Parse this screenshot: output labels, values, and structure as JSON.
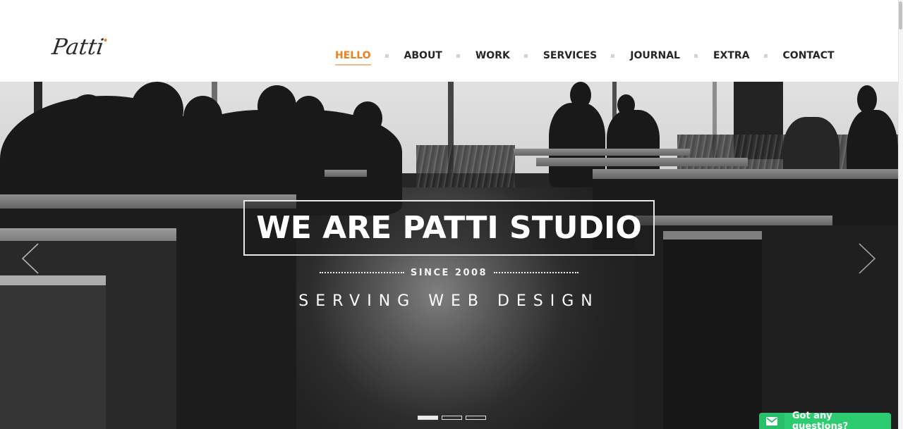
{
  "brand": {
    "logo_text": "Patti",
    "accent_color": "#f07f1f"
  },
  "nav": {
    "items": [
      {
        "label": "HELLO",
        "active": true
      },
      {
        "label": "ABOUT",
        "active": false
      },
      {
        "label": "WORK",
        "active": false
      },
      {
        "label": "SERVICES",
        "active": false
      },
      {
        "label": "JOURNAL",
        "active": false
      },
      {
        "label": "EXTRA",
        "active": false
      },
      {
        "label": "CONTACT",
        "active": false
      }
    ],
    "separator_icon": "square-dot-icon"
  },
  "hero": {
    "title": "WE ARE PATTI STUDIO",
    "since": "SINCE 2008",
    "subtitle": "SERVING WEB DESIGN",
    "prev_icon": "chevron-left-icon",
    "next_icon": "chevron-right-icon",
    "slides": {
      "count": 3,
      "active_index": 0
    },
    "background": "black-and-white photo of people seated at tables in a bright cafeteria"
  },
  "chat_widget": {
    "label": "Got any questions?",
    "icon": "envelope-icon",
    "color": "#2ecc71"
  }
}
